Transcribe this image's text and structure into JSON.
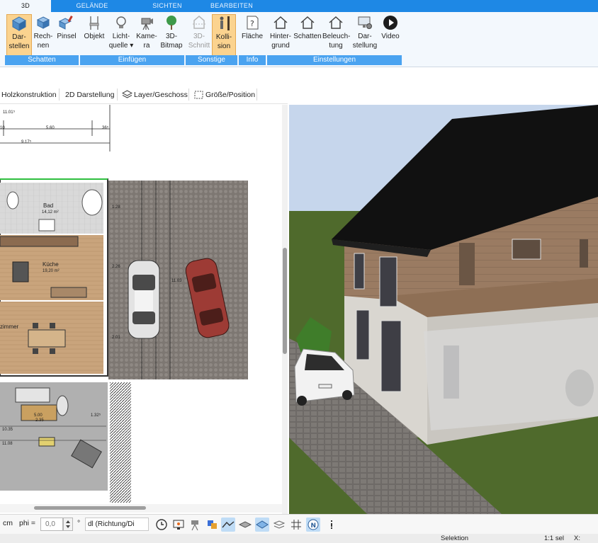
{
  "tabs": [
    {
      "label": "3D",
      "active": true
    },
    {
      "label": "GELÄNDE",
      "active": false
    },
    {
      "label": "SICHTEN",
      "active": false
    },
    {
      "label": "BEARBEITEN",
      "active": false
    }
  ],
  "ribbon": {
    "buttons": [
      {
        "line1": "Dar-",
        "line2": "stellen",
        "icon": "cube-icon",
        "selected": true
      },
      {
        "line1": "Rech-",
        "line2": "nen",
        "icon": "cube-compute-icon"
      },
      {
        "line1": "Pinsel",
        "line2": "",
        "icon": "paint-brush-icon"
      },
      {
        "line1": "Objekt",
        "line2": "",
        "icon": "chair-icon"
      },
      {
        "line1": "Licht-",
        "line2": "quelle ▾",
        "icon": "light-bulb-icon"
      },
      {
        "line1": "Kame-",
        "line2": "ra",
        "icon": "camera-icon"
      },
      {
        "line1": "3D-",
        "line2": "Bitmap",
        "icon": "tree-icon"
      },
      {
        "line1": "3D-",
        "line2": "Schnitt",
        "icon": "section-cut-icon",
        "disabled": true
      },
      {
        "line1": "Kolli-",
        "line2": "sion",
        "icon": "collision-person-icon",
        "selected": true
      },
      {
        "line1": "Fläche",
        "line2": "",
        "icon": "area-info-icon"
      },
      {
        "line1": "Hinter-",
        "line2": "grund",
        "icon": "house-background-icon"
      },
      {
        "line1": "Schatten",
        "line2": "",
        "icon": "house-shadow-icon"
      },
      {
        "line1": "Beleuch-",
        "line2": "tung",
        "icon": "house-lighting-icon"
      },
      {
        "line1": "Dar-",
        "line2": "stellung",
        "icon": "monitor-settings-icon"
      },
      {
        "line1": "Video",
        "line2": "",
        "icon": "play-circle-icon"
      }
    ],
    "groups": [
      "Schatten",
      "Einfügen",
      "Sonstige",
      "Info",
      "Einstellungen"
    ]
  },
  "subtoolbar": {
    "items": [
      "Holzkonstruktion",
      "2D Darstellung",
      "Layer/Geschoss",
      "Größe/Position"
    ]
  },
  "plan": {
    "dimensions": [
      "11.01⁵",
      "5.60",
      "36⁵",
      "9.17⁵",
      "10"
    ],
    "rooms": [
      {
        "name": "Bad",
        "area": "14,12 m²"
      },
      {
        "name": "Küche",
        "area": "19,20 m²"
      },
      {
        "name": "zimmer",
        "area": ""
      },
      {
        "name": "",
        "area": "5.00"
      }
    ],
    "extra_labels": [
      "2.35",
      "10.35",
      "11.08",
      "1.32⁵",
      "2.26",
      "2.01",
      "1.28",
      "11.03"
    ]
  },
  "bottombar": {
    "unit": "cm",
    "phi_label": "phi =",
    "phi_value": "0,0",
    "degree": "°",
    "dl_select": "dl (Richtung/Di"
  },
  "status": {
    "mode": "Selektion",
    "scale": "1:1 sel",
    "x_label": "X:"
  },
  "colors": {
    "tab_blue": "#1e88e5",
    "group_blue": "#4aa3f0",
    "selected_orange": "#fbd38f"
  }
}
